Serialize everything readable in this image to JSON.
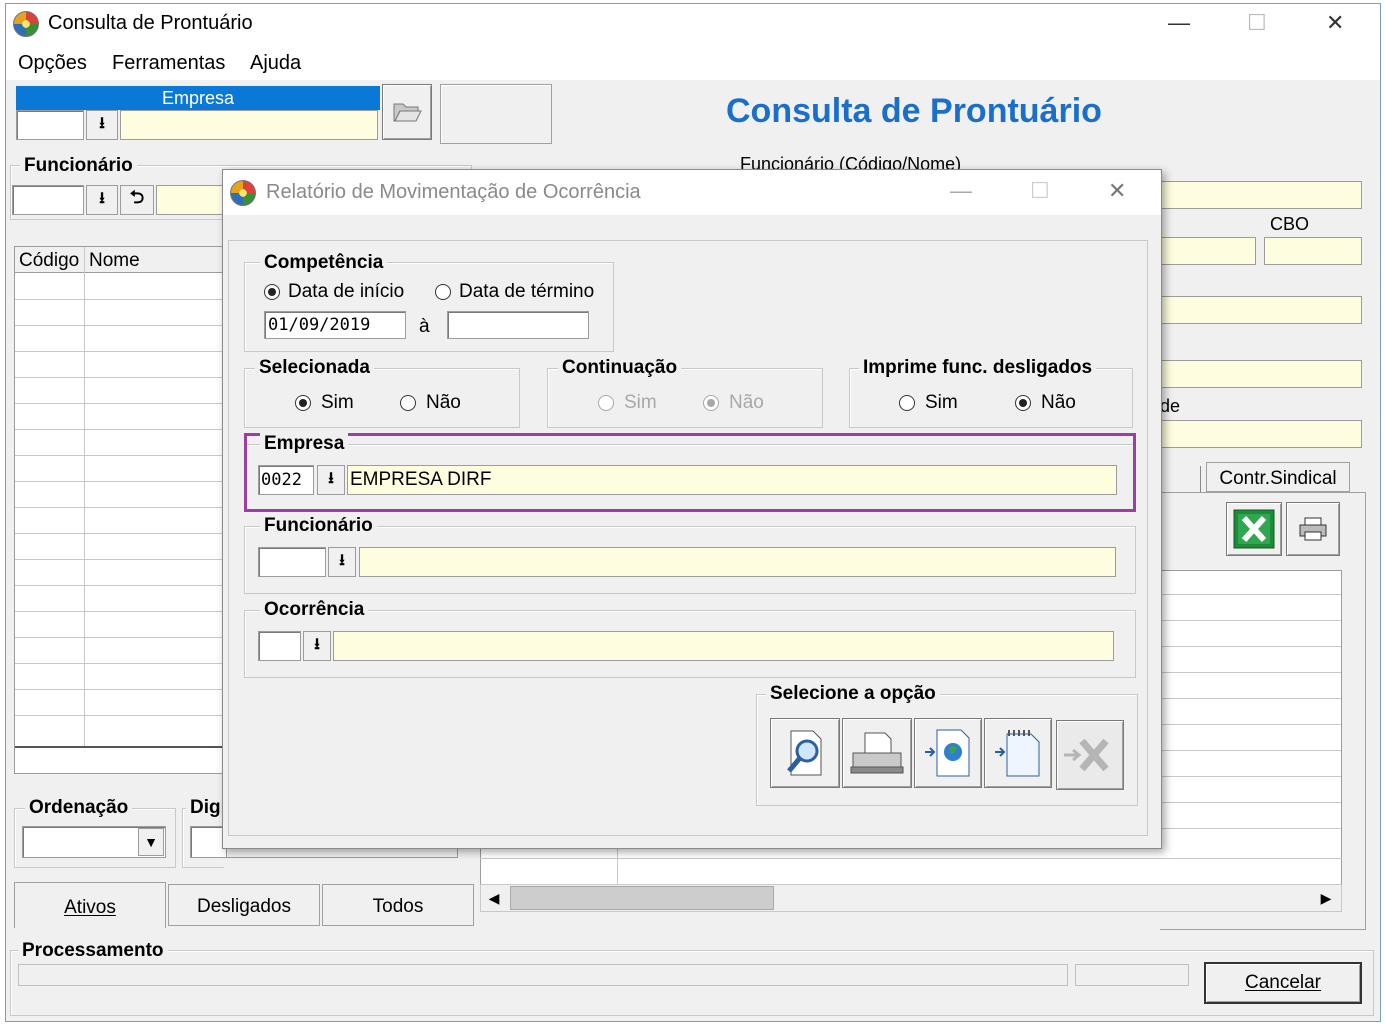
{
  "main_window": {
    "title": "Consulta de Prontuário",
    "controls": [
      "—",
      "☐",
      "✕"
    ],
    "menu": [
      "Opções",
      "Ferramentas",
      "Ajuda"
    ],
    "empresa_header": "Empresa",
    "heading": "Consulta de Prontuário",
    "funcionario_group": "Funcionário",
    "funcionario_codigo_nome_label": "Funcionário (Código/Nome)",
    "cbo_label": "CBO",
    "partial_label_de": "de",
    "grid_columns": [
      "Código",
      "Nome"
    ],
    "ordenacao_label": "Ordenação",
    "digi_label": "Digi",
    "tabs": [
      "Ativos",
      "Desligados",
      "Todos"
    ],
    "contr_sindical_tab": "Contr.Sindical",
    "processamento_label": "Processamento",
    "cancel_button": "Cancelar"
  },
  "dialog": {
    "title": "Relatório de Movimentação de Ocorrência",
    "controls": [
      "—",
      "☐",
      "✕"
    ],
    "competencia": {
      "label": "Competência",
      "option_inicio": "Data de início",
      "option_termino": "Data de término",
      "selected": "Data de início",
      "date_from": "01/09/2019",
      "separator": "à",
      "date_to": ""
    },
    "selecionada": {
      "label": "Selecionada",
      "sim": "Sim",
      "nao": "Não",
      "selected": "Sim"
    },
    "continuacao": {
      "label": "Continuação",
      "sim": "Sim",
      "nao": "Não",
      "selected": "Não",
      "disabled": true
    },
    "imprime": {
      "label": "Imprime func. desligados",
      "sim": "Sim",
      "nao": "Não",
      "selected": "Não"
    },
    "empresa": {
      "label": "Empresa",
      "code": "0022",
      "name": "EMPRESA DIRF",
      "highlight_color": "#9b3fa0"
    },
    "funcionario": {
      "label": "Funcionário",
      "code": "",
      "name": ""
    },
    "ocorrencia": {
      "label": "Ocorrência",
      "code": "",
      "name": ""
    },
    "selecione": {
      "label": "Selecione a opção",
      "buttons": [
        "preview-icon",
        "printer-icon",
        "export-web-icon",
        "export-text-icon",
        "export-excel-disabled-icon"
      ]
    }
  },
  "colors": {
    "title_blue": "#1a6fc9",
    "selected_header": "#0a78d7",
    "input_yellow": "#fffde0",
    "excel_green": "#1f8a3a"
  }
}
